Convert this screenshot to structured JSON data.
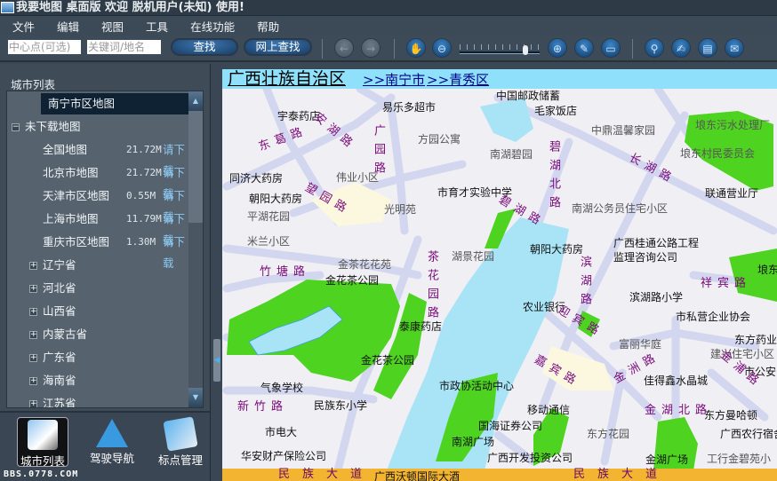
{
  "window": {
    "title": "我要地图 桌面版  欢迎 脱机用户(未知) 使用!"
  },
  "menu": [
    "文件",
    "编辑",
    "视图",
    "工具",
    "在线功能",
    "帮助"
  ],
  "toolbar": {
    "center_placeholder": "中心点(可选)",
    "keyword_placeholder": "关键词/地名",
    "search_label": "查找",
    "online_search_label": "网上查找",
    "icons": [
      "back-icon",
      "forward-icon",
      "pan-hand-icon",
      "zoom-out-icon",
      "zoom-in-icon",
      "measure-ruler-icon",
      "open-folder-icon",
      "pin-icon",
      "edit-note-icon",
      "print-icon",
      "mail-icon"
    ],
    "zoom_level_fraction": 0.85
  },
  "sidebar": {
    "title": "城市列表",
    "selected": "南宁市区地图",
    "group": "未下载地图",
    "downloads": [
      {
        "name": "全国地图",
        "size": "21.72M",
        "action": "请下载"
      },
      {
        "name": "北京市地图",
        "size": "21.72M",
        "action": "请下载"
      },
      {
        "name": "天津市区地图",
        "size": "0.55M",
        "action": "请下载"
      },
      {
        "name": "上海市地图",
        "size": "11.79M",
        "action": "请下载"
      },
      {
        "name": "重庆市区地图",
        "size": "1.30M",
        "action": "请下载"
      }
    ],
    "provinces": [
      "辽宁省",
      "河北省",
      "山西省",
      "内蒙古省",
      "广东省",
      "海南省",
      "江苏省"
    ]
  },
  "bottom_nav": [
    {
      "label": "城市列表",
      "active": true
    },
    {
      "label": "驾驶导航"
    },
    {
      "label": "标点管理"
    }
  ],
  "watermark": "BBS.0778.COM",
  "map": {
    "breadcrumb": {
      "province": "广西壮族自治区",
      "city": ">>南宁市",
      "district": ">>青秀区"
    },
    "colors": {
      "land": "#f0eff4",
      "road": "#d2d6ee",
      "water": "#a8e4f6",
      "park": "#4fd321",
      "major_road": "#f2b431"
    },
    "places": [
      "宇泰药店",
      "易乐多超市",
      "方园公寓",
      "同济大药房",
      "伟业小区",
      "朝阳大药房",
      "市育才实验中学",
      "平湖花园",
      "光明苑",
      "米兰小区",
      "金茶花花苑",
      "湖景花园",
      "中国邮政储蓄",
      "毛家饭店",
      "中鼎温馨家园",
      "南湖碧园",
      "埌东污水处理厂",
      "埌东村民委员会",
      "联通营业厅",
      "南湖公务员住宅小区",
      "朝阳大药房",
      "广西桂通公路工程",
      "监理咨询公司",
      "埌东",
      "金花茶公园",
      "金花茶公园",
      "泰康药店",
      "滨湖路小学",
      "农业银行",
      "市私营企业协会",
      "富丽华庭",
      "东方药业",
      "建兴住宅小区",
      "佳得鑫水晶城",
      "市公安",
      "气象学校",
      "市政协活动中心",
      "民族东小学",
      "移动通信",
      "东方曼哈顿",
      "市电大",
      "国海证券公司",
      "东方花园",
      "广西农行宿舍",
      "南湖广场",
      "金湖广场",
      "工行金碧苑小",
      "华安财产保险公司",
      "广西开发投资公司",
      "广西沃顿国际大酒"
    ],
    "roads": [
      "东葛路",
      "安湖路",
      "广园路",
      "望园路",
      "竹塘路",
      "碧湖北路",
      "长湖路",
      "碧湖路",
      "茶花园路",
      "滨湖路",
      "迎宾路",
      "嘉宾路",
      "金洲路",
      "祥宾路",
      "金浦路",
      "金湖北路",
      "新竹路",
      "民族大道",
      "民族大道"
    ]
  }
}
